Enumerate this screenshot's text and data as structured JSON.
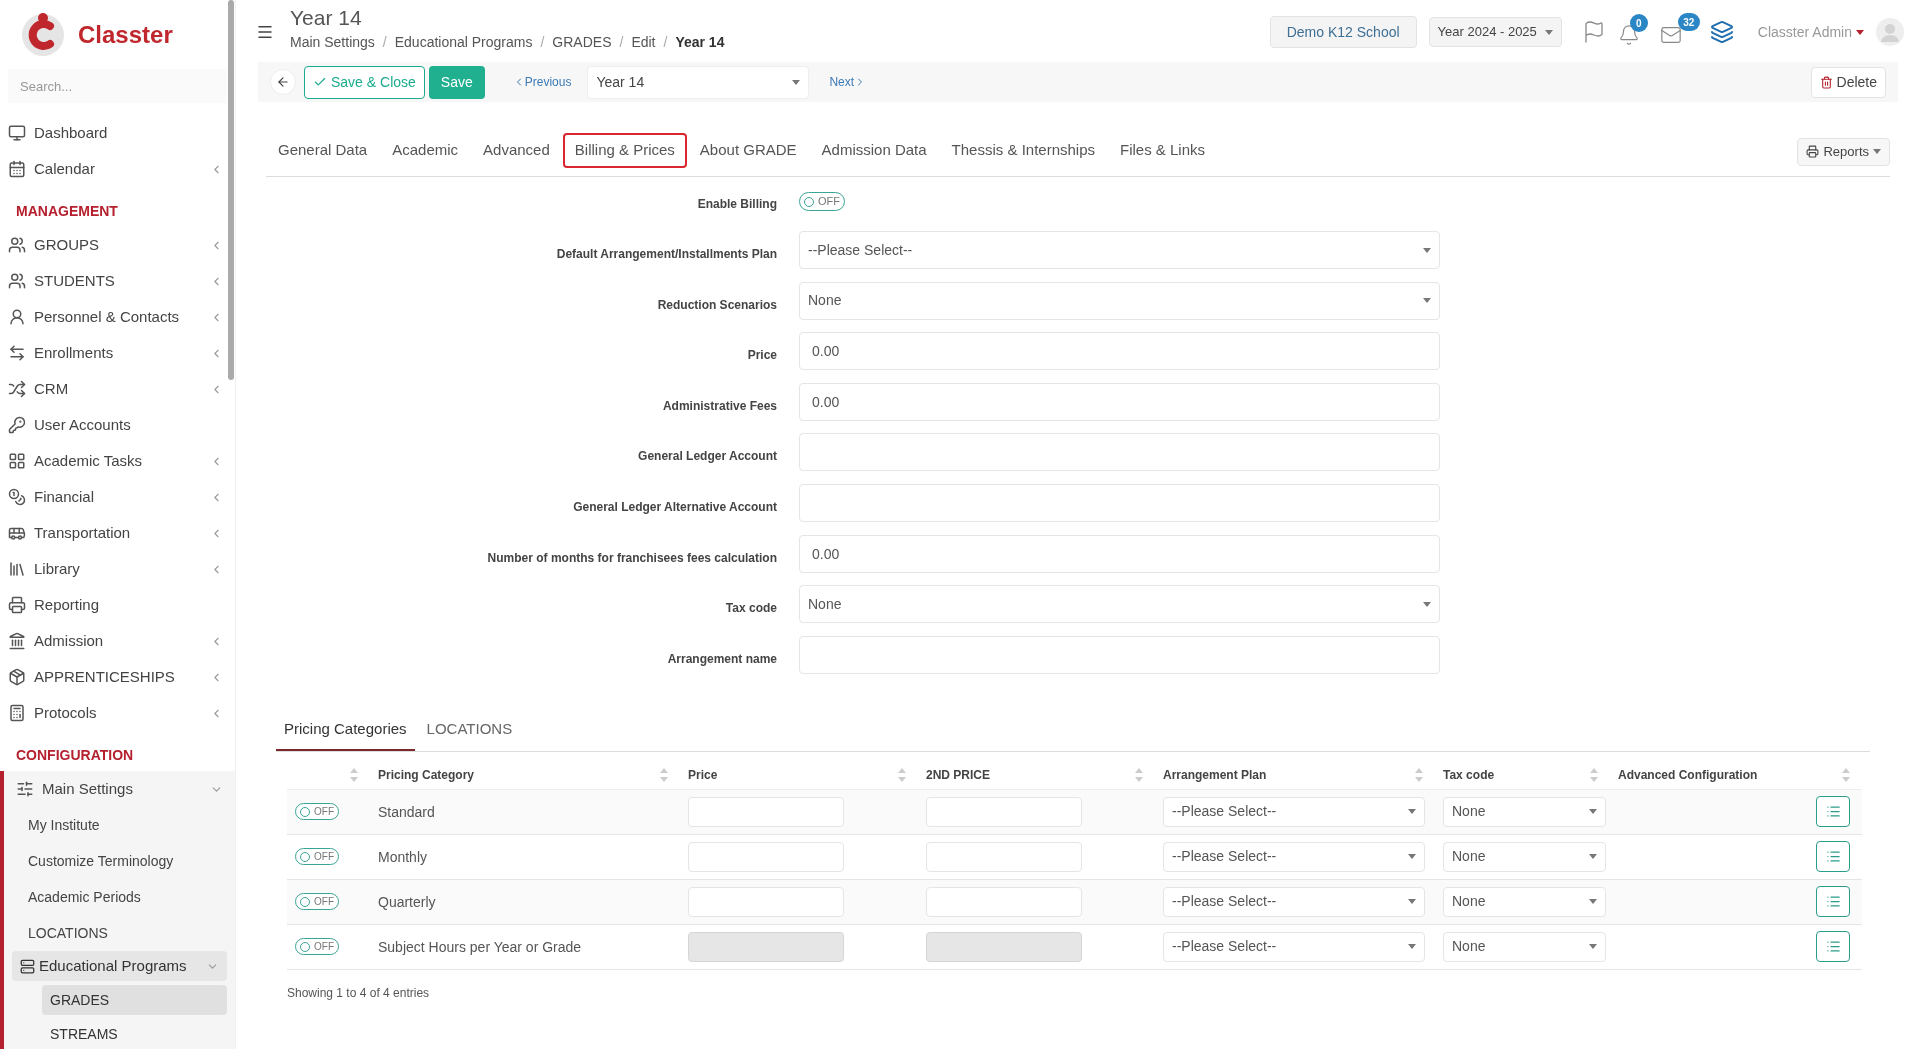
{
  "brand": {
    "name": "Classter"
  },
  "sidebar": {
    "search": {
      "placeholder": "Search..."
    },
    "items": [
      {
        "kind": "link",
        "label": "Dashboard",
        "has_submenu": false
      },
      {
        "kind": "link",
        "label": "Calendar",
        "has_submenu": true
      },
      {
        "kind": "heading",
        "label": "MANAGEMENT"
      },
      {
        "kind": "link",
        "label": "GROUPS",
        "has_submenu": true
      },
      {
        "kind": "link",
        "label": "STUDENTS",
        "has_submenu": true
      },
      {
        "kind": "link",
        "label": "Personnel & Contacts",
        "has_submenu": true
      },
      {
        "kind": "link",
        "label": "Enrollments",
        "has_submenu": true
      },
      {
        "kind": "link",
        "label": "CRM",
        "has_submenu": true
      },
      {
        "kind": "link",
        "label": "User Accounts",
        "has_submenu": false
      },
      {
        "kind": "link",
        "label": "Academic Tasks",
        "has_submenu": true
      },
      {
        "kind": "link",
        "label": "Financial",
        "has_submenu": true
      },
      {
        "kind": "link",
        "label": "Transportation",
        "has_submenu": true
      },
      {
        "kind": "link",
        "label": "Library",
        "has_submenu": true
      },
      {
        "kind": "link",
        "label": "Reporting",
        "has_submenu": false
      },
      {
        "kind": "link",
        "label": "Admission",
        "has_submenu": true
      },
      {
        "kind": "link",
        "label": "APPRENTICESHIPS",
        "has_submenu": true
      },
      {
        "kind": "link",
        "label": "Protocols",
        "has_submenu": true
      },
      {
        "kind": "heading",
        "label": "CONFIGURATION"
      },
      {
        "kind": "link",
        "label": "Main Settings",
        "has_submenu": true,
        "expanded": true,
        "children": [
          {
            "label": "My Institute",
            "selected": false
          },
          {
            "label": "Customize Terminology",
            "selected": false
          },
          {
            "label": "Academic Periods",
            "selected": false
          },
          {
            "label": "LOCATIONS",
            "selected": false
          },
          {
            "label": "Educational Programs",
            "selected": false,
            "expanded": true,
            "children": [
              {
                "label": "GRADES",
                "selected": true
              },
              {
                "label": "STREAMS",
                "selected": false
              }
            ]
          }
        ]
      }
    ]
  },
  "header": {
    "title": "Year 14",
    "breadcrumbs": [
      {
        "label": "Main Settings",
        "current": false
      },
      {
        "label": "Educational Programs",
        "current": false
      },
      {
        "label": "GRADES",
        "current": false
      },
      {
        "label": "Edit",
        "current": false
      },
      {
        "label": "Year 14",
        "current": true
      }
    ],
    "separator": "/",
    "school": "Demo K12 School",
    "year": "Year 2024 - 2025",
    "notifications": "0",
    "messages": "32",
    "user": "Classter Admin"
  },
  "toolbar": {
    "save_close": "Save & Close",
    "save": "Save",
    "previous": "Previous",
    "record": "Year 14",
    "next": "Next",
    "delete": "Delete"
  },
  "tabs": [
    {
      "label": "General Data",
      "selected": false
    },
    {
      "label": "Academic",
      "selected": false
    },
    {
      "label": "Advanced",
      "selected": false
    },
    {
      "label": "Billing & Prices",
      "selected": true
    },
    {
      "label": "About GRADE",
      "selected": false
    },
    {
      "label": "Admission Data",
      "selected": false
    },
    {
      "label": "Thessis & Internships",
      "selected": false
    },
    {
      "label": "Files & Links",
      "selected": false
    }
  ],
  "reports": "Reports",
  "form": [
    {
      "kind": "toggle",
      "label": "Enable Billing",
      "on": false,
      "value": "OFF"
    },
    {
      "kind": "select",
      "label": "Default Arrangement/Installments Plan",
      "value": "--Please Select--"
    },
    {
      "kind": "select",
      "label": "Reduction Scenarios",
      "value": "None"
    },
    {
      "kind": "input",
      "label": "Price",
      "value": "0.00"
    },
    {
      "kind": "input",
      "label": "Administrative Fees",
      "value": "0.00"
    },
    {
      "kind": "input",
      "label": "General Ledger Account"
    },
    {
      "kind": "input",
      "label": "General Ledger Alternative Account"
    },
    {
      "kind": "input",
      "label": "Number of months for franchisees fees calculation",
      "value": "0.00"
    },
    {
      "kind": "select",
      "label": "Tax code",
      "value": "None"
    },
    {
      "kind": "input",
      "label": "Arrangement name"
    }
  ],
  "subtabs": [
    {
      "label": "Pricing Categories",
      "selected": true
    },
    {
      "label": "LOCATIONS",
      "selected": false
    }
  ],
  "table": {
    "columns": [
      {
        "sortable": true
      },
      {
        "label": "Pricing Category",
        "sortable": true
      },
      {
        "label": "Price",
        "sortable": true
      },
      {
        "label": "2ND PRICE",
        "sortable": true
      },
      {
        "label": "Arrangement Plan",
        "sortable": true
      },
      {
        "label": "Tax code",
        "sortable": true
      },
      {
        "label": "Advanced Configuration",
        "sortable": true
      }
    ],
    "rows": [
      {
        "on": false,
        "toggle": "OFF",
        "name": "Standard",
        "disabled": false,
        "arrangement": "--Please Select--",
        "tax": "None"
      },
      {
        "on": false,
        "toggle": "OFF",
        "name": "Monthly",
        "disabled": false,
        "arrangement": "--Please Select--",
        "tax": "None"
      },
      {
        "on": false,
        "toggle": "OFF",
        "name": "Quarterly",
        "disabled": false,
        "arrangement": "--Please Select--",
        "tax": "None"
      },
      {
        "on": false,
        "toggle": "OFF",
        "name": "Subject Hours per Year or Grade",
        "disabled": true,
        "arrangement": "--Please Select--",
        "tax": "None"
      }
    ],
    "footer": "Showing 1 to 4 of 4 entries"
  }
}
